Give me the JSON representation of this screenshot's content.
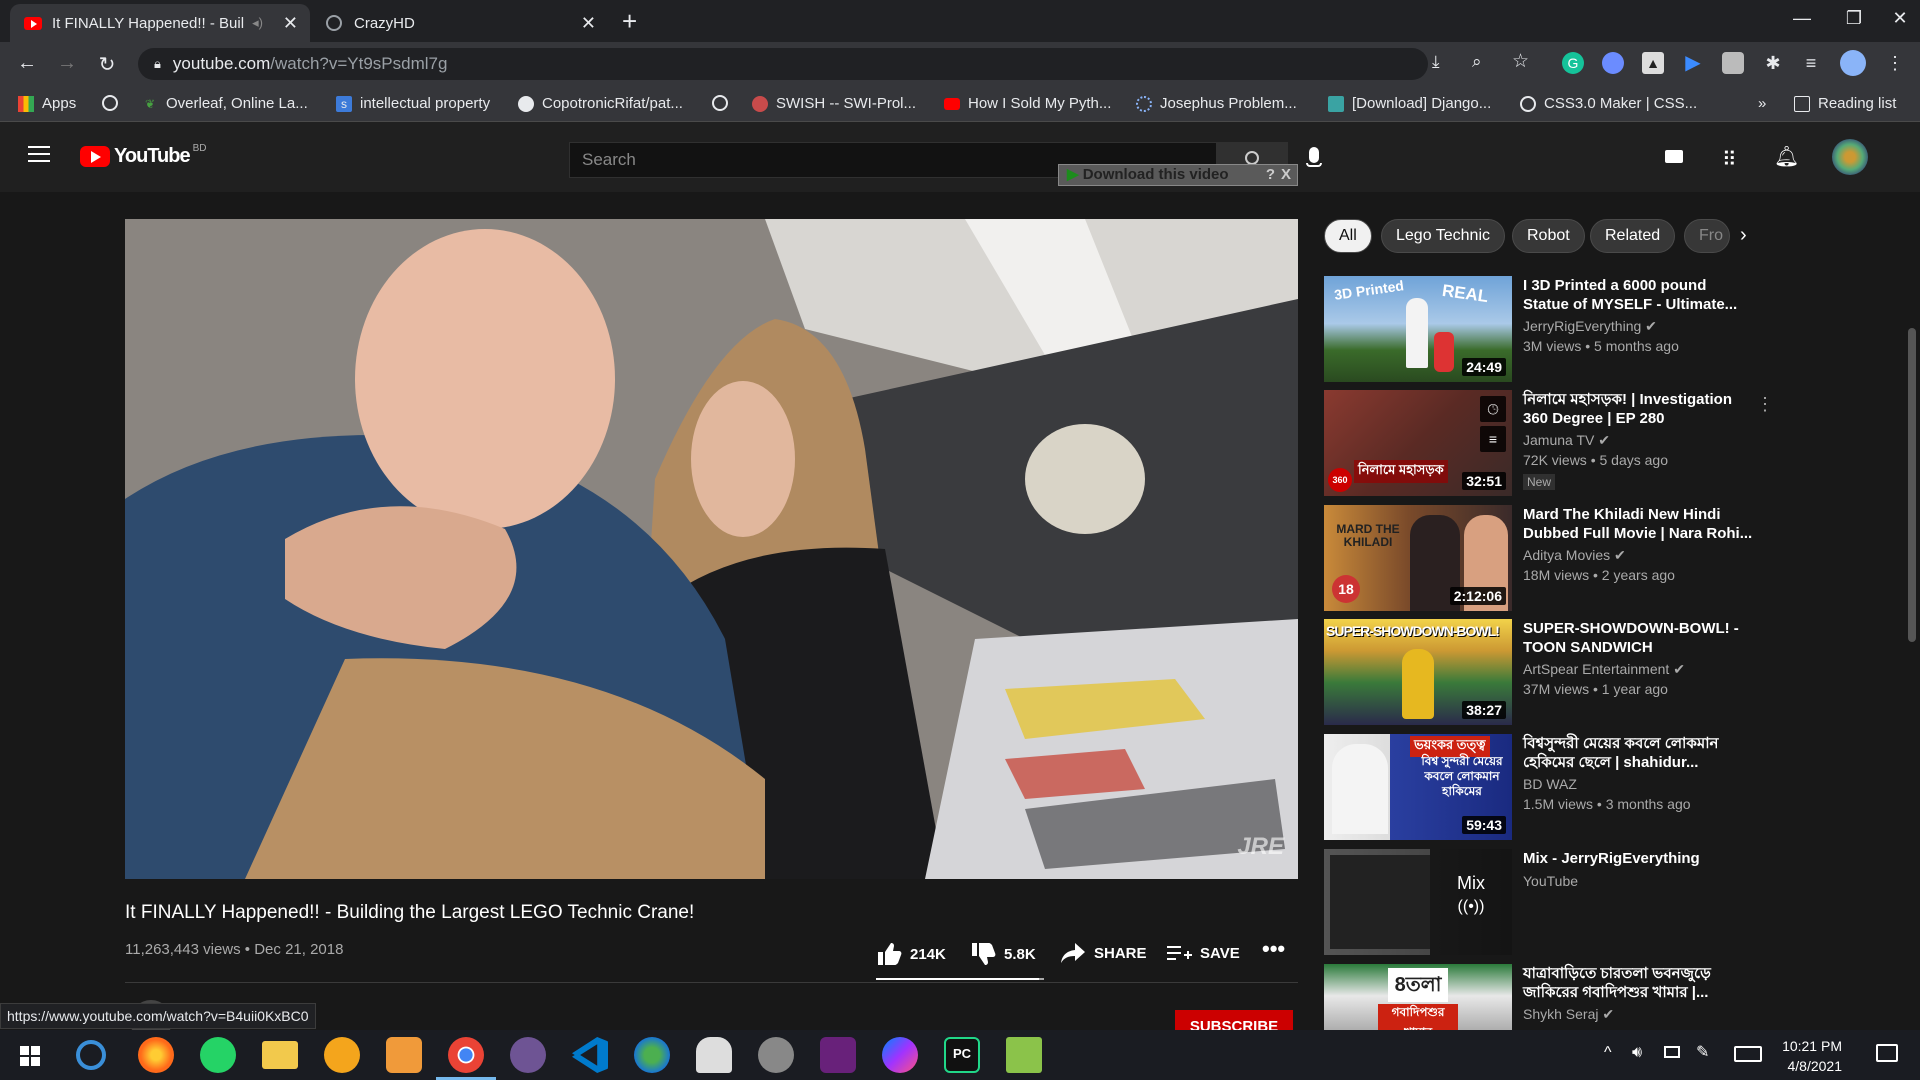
{
  "browser": {
    "tabs": [
      {
        "title": "It FINALLY Happened!! - Buil",
        "active": true
      },
      {
        "title": "CrazyHD",
        "active": false
      }
    ],
    "url_host": "youtube.com",
    "url_path": "/watch?v=Yt9sPsdml7g",
    "bookmarks": [
      {
        "label": "Apps"
      },
      {
        "label": ""
      },
      {
        "label": "Overleaf, Online La..."
      },
      {
        "label": "intellectual property"
      },
      {
        "label": "CopotronicRifat/pat..."
      },
      {
        "label": ""
      },
      {
        "label": "SWISH -- SWI-Prol..."
      },
      {
        "label": "How I Sold My Pyth..."
      },
      {
        "label": "Josephus Problem..."
      },
      {
        "label": "[Download] Django..."
      },
      {
        "label": "CSS3.0 Maker | CSS..."
      }
    ],
    "bookmarks_more": "»",
    "reading_list": "Reading list",
    "status_url": "https://www.youtube.com/watch?v=B4uii0KxBC0"
  },
  "youtube": {
    "logo_text": "YouTube",
    "logo_region": "BD",
    "search_placeholder": "Search",
    "download_bar": "Download this video",
    "download_help": "?",
    "download_close": "X",
    "watermark": "JRE",
    "video": {
      "title": "It FINALLY Happened!! - Building the Largest LEGO Technic Crane!",
      "meta": "11,263,443 views • Dec 21, 2018",
      "likes": "214K",
      "dislikes": "5.8K",
      "share": "SHARE",
      "save": "SAVE",
      "like_ratio": 0.97
    },
    "subscribe": "SUBSCRIBE",
    "chips": [
      "All",
      "Lego Technic",
      "Robot",
      "Related",
      "Fro"
    ],
    "recommendations": [
      {
        "title": "I 3D Printed a 6000 pound Statue of MYSELF - Ultimate...",
        "channel": "JerryRigEverything",
        "meta": "3M views • 5 months ago",
        "duration": "24:49",
        "thumb_color": "#3b6aa3",
        "thumb_text_1": "3D Printed",
        "thumb_text_2": "REAL"
      },
      {
        "title": "নিলামে মহাসড়ক! | Investigation 360 Degree | EP 280",
        "channel": "Jamuna TV",
        "meta": "72K views • 5 days ago",
        "duration": "32:51",
        "badge": "New",
        "thumb_color": "#7a2b24",
        "thumb_text_1": "নিলামে মহাসড়ক",
        "thumb_text_2": "360"
      },
      {
        "title": "Mard The Khiladi New Hindi Dubbed Full Movie | Nara Rohi...",
        "channel": "Aditya Movies",
        "meta": "18M views • 2 years ago",
        "duration": "2:12:06",
        "thumb_color": "#8a5a2a",
        "thumb_text_1": "MARD THE KHILADI",
        "thumb_text_2": "18"
      },
      {
        "title": "SUPER-SHOWDOWN-BOWL! - TOON SANDWICH",
        "channel": "ArtSpear Entertainment",
        "meta": "37M views • 1 year ago",
        "duration": "38:27",
        "thumb_color": "#4a7a3a",
        "thumb_text_1": "SUPER-SHOWDOWN-BOWL!",
        "thumb_text_2": ""
      },
      {
        "title": "বিশ্বসুন্দরী মেয়ের কবলে লোকমান হেকিমের ছেলে | shahidur...",
        "channel": "BD WAZ",
        "meta": "1.5M views • 3 months ago",
        "duration": "59:43",
        "thumb_color": "#2a3fa0",
        "thumb_text_1": "ভয়ংকর তত্ত্ব",
        "thumb_text_2": "বিশ্ব সুন্দরী মেয়ের কবলে লোকমান হাকিমের"
      },
      {
        "title": "Mix - JerryRigEverything",
        "channel": "YouTube",
        "meta": "",
        "duration": "",
        "mix": "Mix",
        "thumb_color": "#3a3a3a",
        "thumb_text_1": "",
        "thumb_text_2": ""
      },
      {
        "title": "যাত্রাবাড়িতে চারতলা ভবনজুড়ে জাকিরের গবাদিপশুর খামার |...",
        "channel": "Shykh Seraj",
        "meta": "",
        "duration": "",
        "thumb_color": "#3d5a3a",
        "thumb_text_1": "8তলা",
        "thumb_text_2": "গবাদিপশুর খামার"
      }
    ]
  },
  "taskbar": {
    "time": "10:21 PM",
    "date": "4/8/2021"
  },
  "colors": {
    "yt_red": "#ff0000",
    "subscribe_red": "#cc0000",
    "chrome_dark": "#202124",
    "chrome_toolbar": "#35363a",
    "page_bg": "#181818"
  }
}
